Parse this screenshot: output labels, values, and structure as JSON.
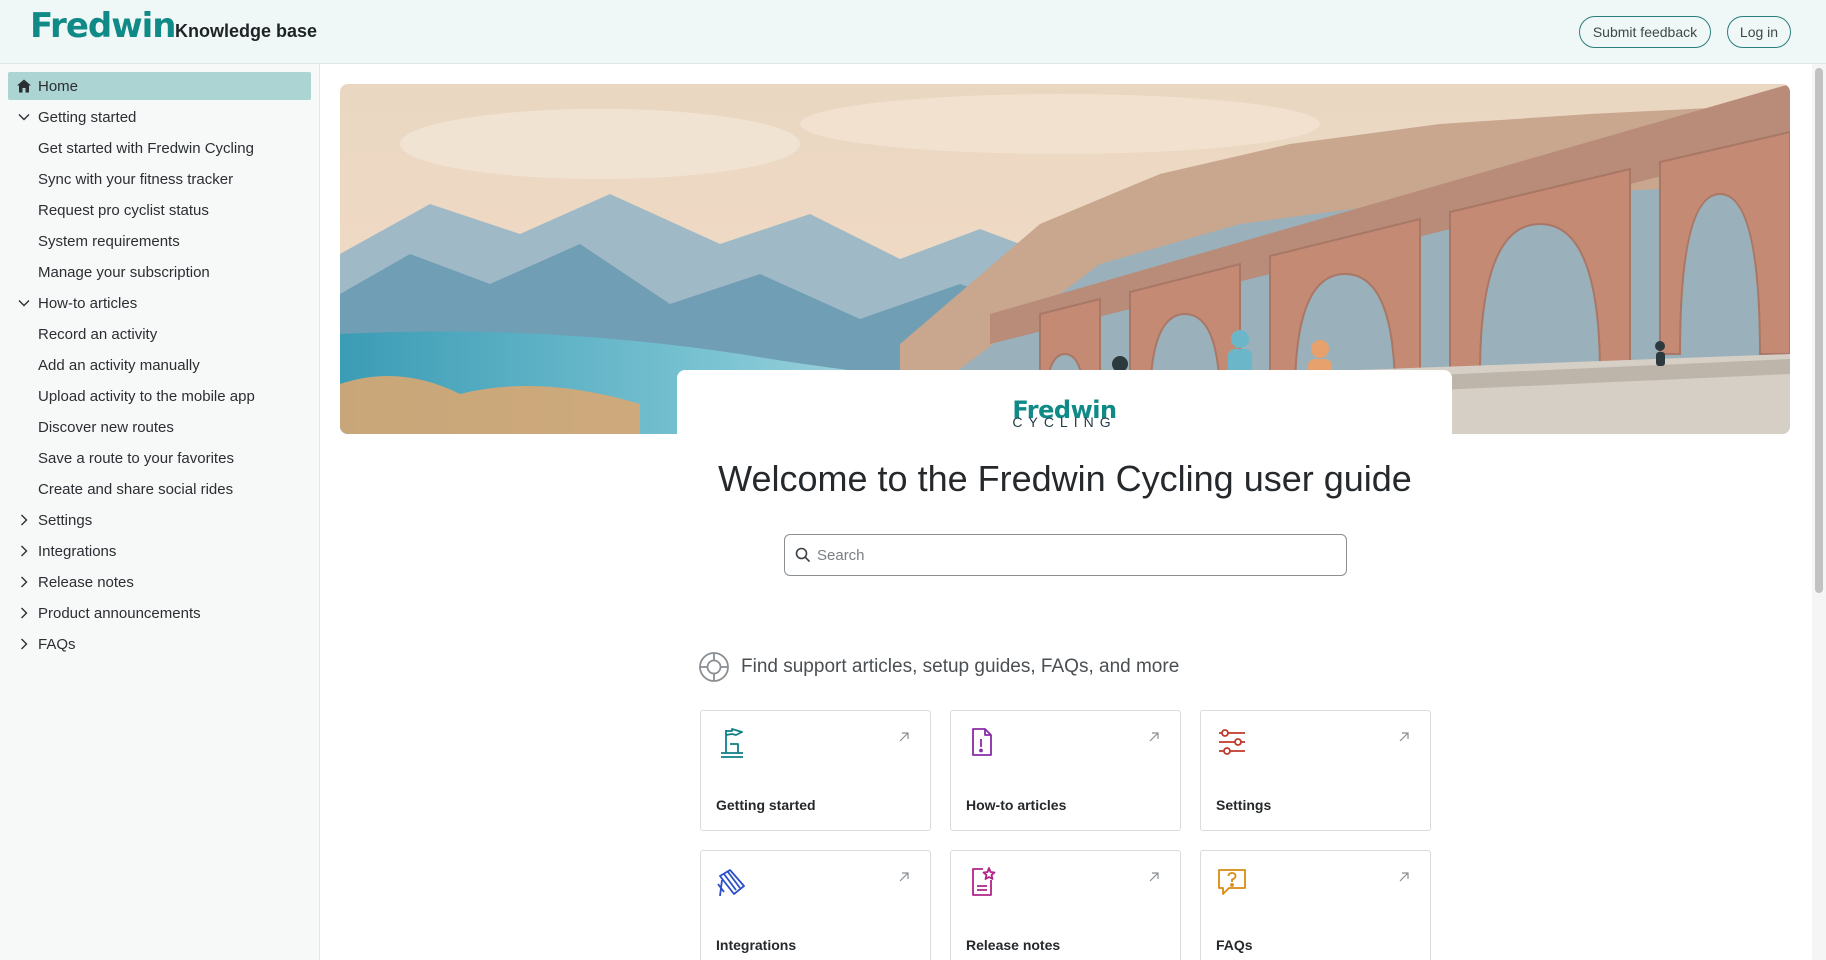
{
  "header": {
    "logo": "Fredwin",
    "subtitle": "Knowledge base",
    "feedback_label": "Submit feedback",
    "login_label": "Log in"
  },
  "sidebar": {
    "items": [
      {
        "label": "Home",
        "level": 0,
        "active": true
      },
      {
        "label": "Getting started",
        "level": 0,
        "expanded": true
      },
      {
        "label": "Get started with Fredwin Cycling",
        "level": 1
      },
      {
        "label": "Sync with your fitness tracker",
        "level": 1
      },
      {
        "label": "Request pro cyclist status",
        "level": 1
      },
      {
        "label": "System requirements",
        "level": 1
      },
      {
        "label": "Manage your subscription",
        "level": 1
      },
      {
        "label": "How-to articles",
        "level": 0,
        "expanded": true
      },
      {
        "label": "Record an activity",
        "level": 1
      },
      {
        "label": "Add an activity manually",
        "level": 1
      },
      {
        "label": "Upload activity to the mobile app",
        "level": 1
      },
      {
        "label": "Discover new routes",
        "level": 1
      },
      {
        "label": "Save a route to your favorites",
        "level": 1
      },
      {
        "label": "Create and share social rides",
        "level": 1
      },
      {
        "label": "Settings",
        "level": 0,
        "expanded": false
      },
      {
        "label": "Integrations",
        "level": 0,
        "expanded": false
      },
      {
        "label": "Release notes",
        "level": 0,
        "expanded": false
      },
      {
        "label": "Product announcements",
        "level": 0,
        "expanded": false
      },
      {
        "label": "FAQs",
        "level": 0,
        "expanded": false
      }
    ]
  },
  "hero": {
    "brand_name": "Fredwin",
    "brand_sub": "CYCLING"
  },
  "main": {
    "title": "Welcome to the Fredwin Cycling user guide",
    "search_placeholder": "Search",
    "section_heading": "Find support articles, setup guides, FAQs, and more",
    "cards": [
      {
        "label": "Getting started",
        "icon": "flag-icon",
        "color": "#0f7f86"
      },
      {
        "label": "How-to articles",
        "icon": "document-info-icon",
        "color": "#8a2ba8"
      },
      {
        "label": "Settings",
        "icon": "sliders-icon",
        "color": "#c0392b"
      },
      {
        "label": "Integrations",
        "icon": "plug-icon",
        "color": "#2b4fc7"
      },
      {
        "label": "Release notes",
        "icon": "document-star-icon",
        "color": "#b0248a"
      },
      {
        "label": "FAQs",
        "icon": "question-bubble-icon",
        "color": "#d88a12"
      }
    ]
  },
  "colors": {
    "brand": "#0f8a86",
    "active_nav": "#acd4d2",
    "header_bg": "#eff7f7"
  }
}
